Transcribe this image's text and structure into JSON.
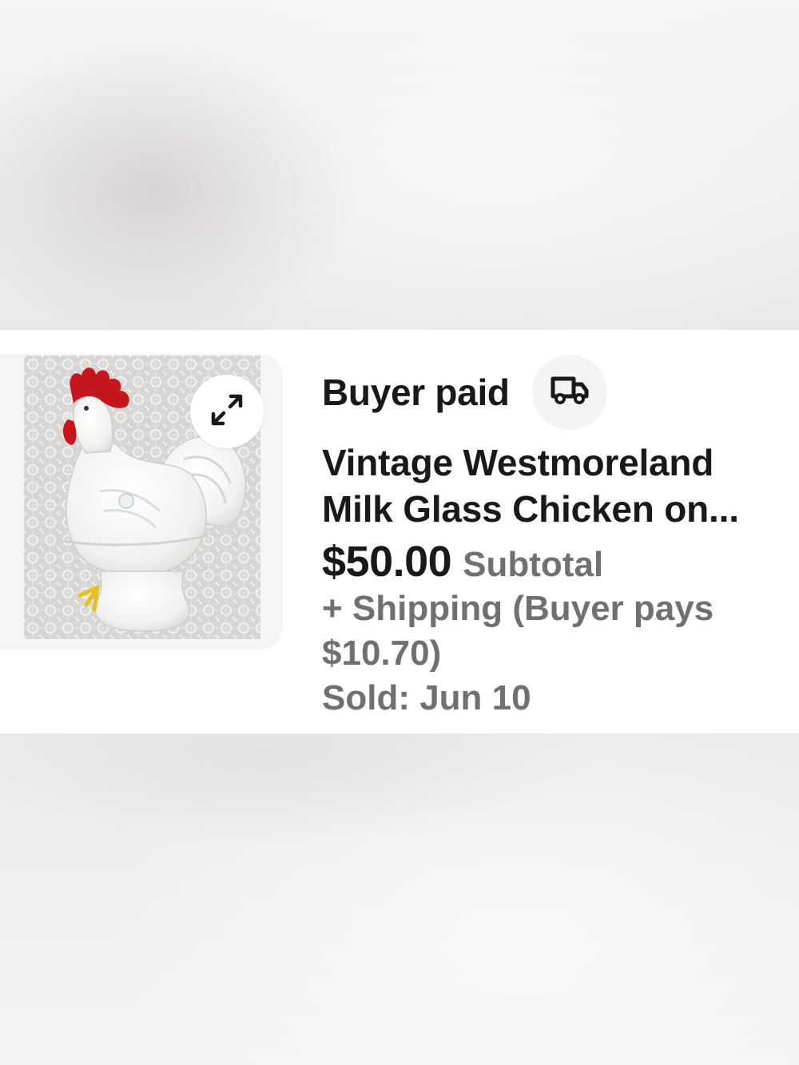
{
  "order": {
    "status": "Buyer paid",
    "title_line1": "Vintage Westmoreland",
    "title_line2": "Milk Glass Chicken on...",
    "price": "$50.00",
    "price_label": "Subtotal",
    "shipping": "+ Shipping (Buyer pays $10.70)",
    "sold": "Sold: Jun 10"
  },
  "icons": {
    "expand": "expand-icon",
    "shipping": "delivery-truck-icon"
  },
  "colors": {
    "primary_text": "#191919",
    "secondary_text": "#707070",
    "card_background": "#ffffff",
    "rooster_comb": "#c4161c"
  }
}
